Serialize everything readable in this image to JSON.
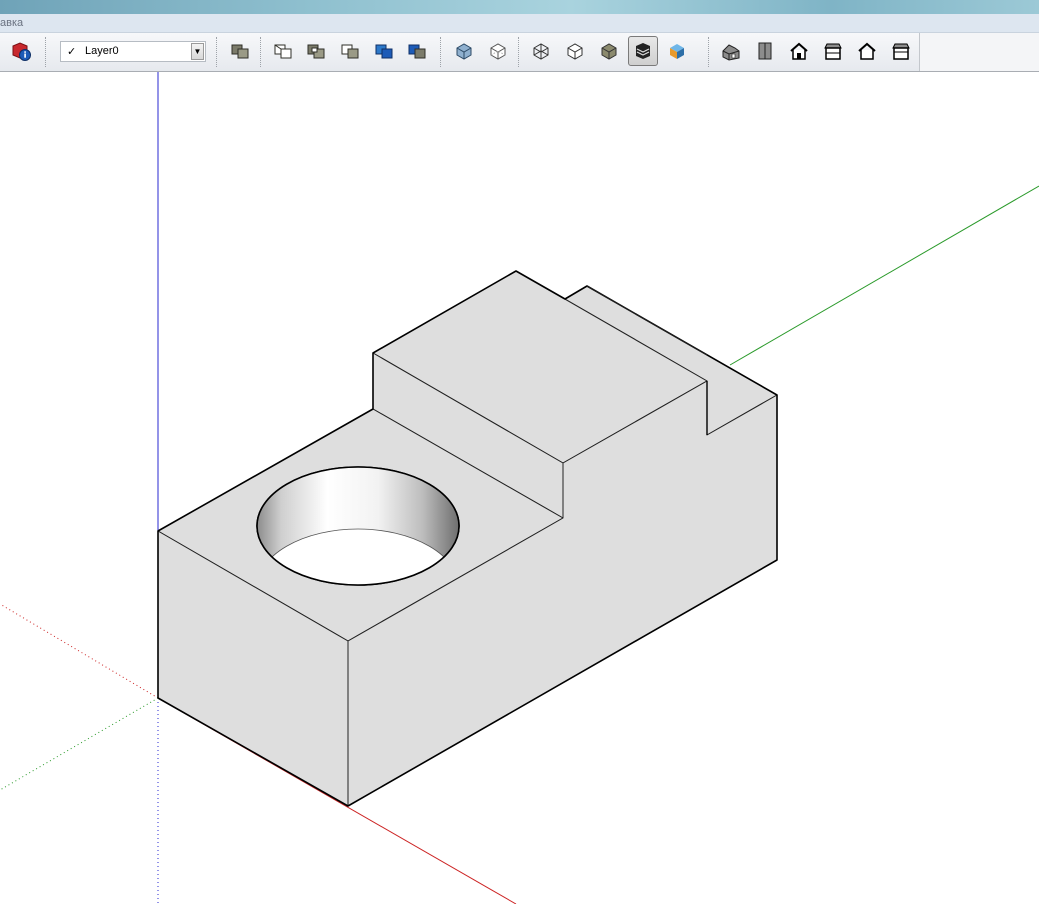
{
  "menu": {
    "partial_label": "авка"
  },
  "toolbar": {
    "layer": {
      "check": "✓",
      "name": "Layer0",
      "arrow": "▼"
    },
    "buttons": [
      "model-info",
      "xray",
      "back-edges",
      "wireframe",
      "hidden-line",
      "shaded",
      "shaded-textures",
      "monochrome",
      "iso",
      "top",
      "front",
      "right",
      "back",
      "left"
    ],
    "active_button": "monochrome-style"
  },
  "scene": {
    "axis_colors": {
      "red": "#cc2222",
      "green": "#2a9a2a",
      "blue": "#2a2ad0"
    },
    "model_face_color": "#dedede",
    "object": "block-with-hole-and-slot"
  }
}
